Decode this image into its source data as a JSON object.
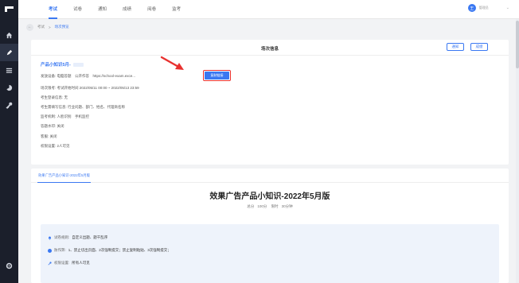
{
  "topbar": {
    "tabs": [
      {
        "label": "考试",
        "active": true
      },
      {
        "label": "试卷",
        "active": false
      },
      {
        "label": "通知",
        "active": false
      },
      {
        "label": "成绩",
        "active": false
      },
      {
        "label": "阅卷",
        "active": false
      },
      {
        "label": "监考",
        "active": false
      }
    ],
    "avatar_text": "王",
    "user_name": "管理员"
  },
  "breadcrumb": {
    "items": [
      "考试",
      "场次预览"
    ],
    "separator": ">"
  },
  "session_card": {
    "title": "场次信息",
    "notify_label": "通知",
    "score_label": "成绩",
    "exam_name": "产品小知识5月-",
    "rows": [
      {
        "key": "发放设备:",
        "value": "电脑答题　公开作答　https://school-exam.exce..."
      },
      {
        "key": "场次限考:",
        "value": "考试开始时间 2022/05/11 00:00 ~ 2022/05/13 23:59"
      },
      {
        "key": "考生登录信息:",
        "value": "无"
      },
      {
        "key": "考生需填写信息:",
        "value": "行业问题、部门、姓名、代理商名称"
      },
      {
        "key": "监考机制:",
        "value": "人脸识别　手机监控"
      },
      {
        "key": "答题水印:",
        "value": "关闭"
      },
      {
        "key": "客服:",
        "value": "关闭"
      },
      {
        "key": "权限设置:",
        "value": "2人可见"
      }
    ],
    "copy_link_label": "复制链接"
  },
  "paper_card": {
    "tab_label": "效果广告产品小知识-2022年5月版",
    "paper_title": "效果广告产品小知识-2022年5月版",
    "total_label": "总分",
    "total_value": "100分",
    "duration_label": "限时",
    "duration_value": "30分钟",
    "rules": [
      {
        "key": "试卷规则:",
        "value": "自定义出题、题干乱序",
        "icon": "bell-icon"
      },
      {
        "key": "防作弊:",
        "value": "1、禁止切出页面、2次强制提交；禁止复制粘贴、3次强制提交；",
        "icon": "info-icon"
      },
      {
        "key": "权限设置:",
        "value": "所有人可见",
        "icon": "key-icon"
      }
    ]
  },
  "colors": {
    "accent": "#3a78f2",
    "sidebar_bg": "#1b1f2b",
    "highlight": "#e8312f"
  }
}
